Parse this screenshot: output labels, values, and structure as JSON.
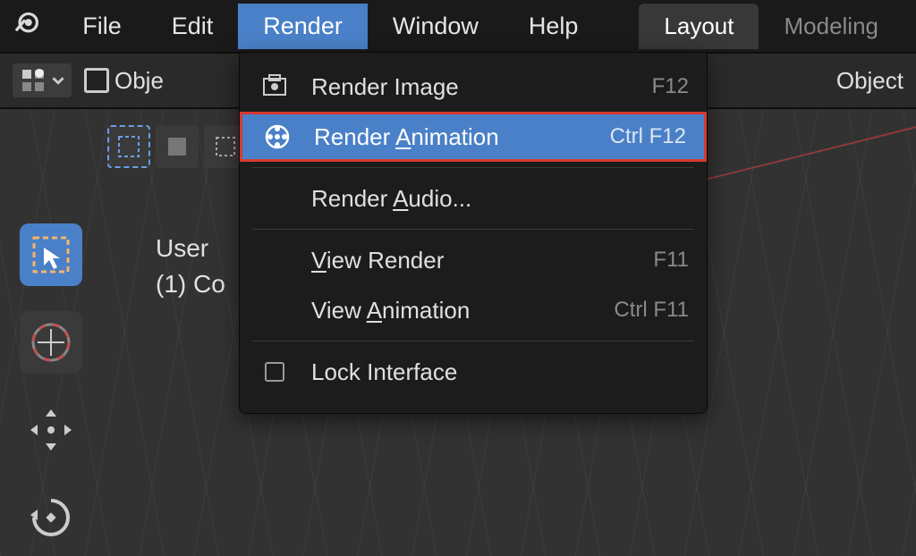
{
  "menubar": {
    "file": "File",
    "edit": "Edit",
    "render": "Render",
    "window": "Window",
    "help": "Help",
    "layout": "Layout",
    "modeling": "Modeling"
  },
  "header": {
    "object_mode_label": "Obje",
    "object_right_label": "Object"
  },
  "viewport": {
    "line1": "User",
    "line2": "(1) Co"
  },
  "render_menu": {
    "render_image": {
      "label": "Render Image",
      "shortcut": "F12"
    },
    "render_animation": {
      "label_pre": "Render ",
      "label_ul": "A",
      "label_post": "nimation",
      "shortcut": "Ctrl F12"
    },
    "render_audio": {
      "label_pre": "Render ",
      "label_ul": "A",
      "label_post": "udio..."
    },
    "view_render": {
      "label_ul": "V",
      "label_post": "iew Render",
      "shortcut": "F11"
    },
    "view_animation": {
      "label_pre": "View ",
      "label_ul": "A",
      "label_post": "nimation",
      "shortcut": "Ctrl F11"
    },
    "lock_interface": {
      "label": "Lock Interface"
    }
  }
}
